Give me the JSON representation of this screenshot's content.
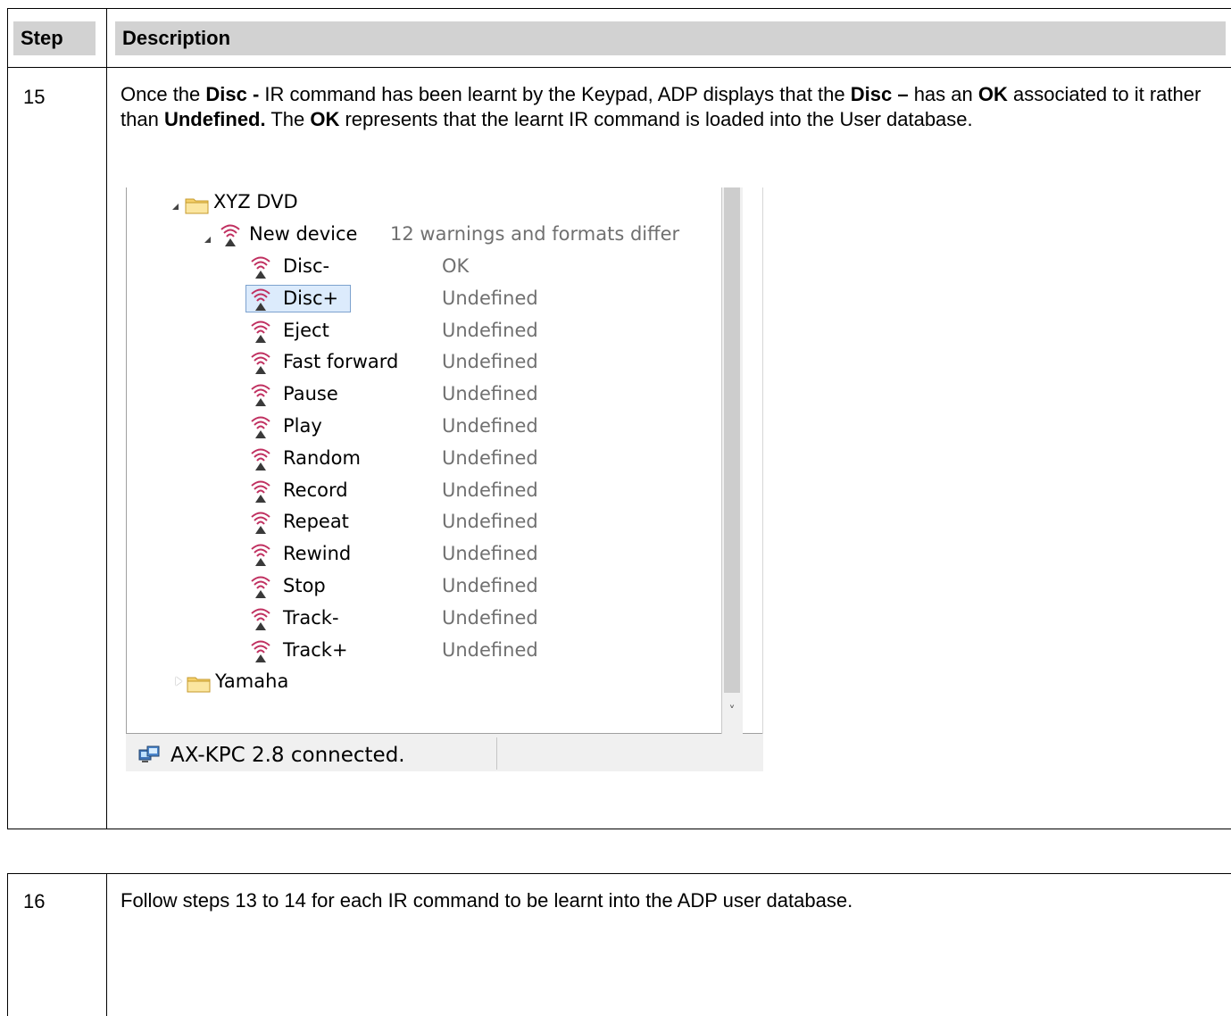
{
  "header": {
    "step": "Step",
    "description": "Description"
  },
  "row15": {
    "step": "15",
    "text": [
      {
        "t": "Once the ",
        "b": false
      },
      {
        "t": "Disc - ",
        "b": true
      },
      {
        "t": "IR command has been learnt by the Keypad, ADP displays that the ",
        "b": false
      },
      {
        "t": "Disc –",
        "b": true
      },
      {
        "t": " has an ",
        "b": false
      },
      {
        "t": "OK",
        "b": true
      },
      {
        "t": " associated to it rather than ",
        "b": false
      },
      {
        "t": "Undefined.",
        "b": true
      },
      {
        "t": " The ",
        "b": false
      },
      {
        "t": "OK",
        "b": true
      },
      {
        "t": " represents that the learnt IR command is loaded into the User database.",
        "b": false
      }
    ]
  },
  "tree": {
    "folder1": "XYZ DVD",
    "device": {
      "name": "New device",
      "status": "12 warnings and formats differ"
    },
    "commands": [
      {
        "name": "Disc-",
        "status": "OK"
      },
      {
        "name": "Disc+",
        "status": "Undefined",
        "selected": true
      },
      {
        "name": "Eject",
        "status": "Undefined"
      },
      {
        "name": "Fast forward",
        "status": "Undefined"
      },
      {
        "name": "Pause",
        "status": "Undefined"
      },
      {
        "name": "Play",
        "status": "Undefined"
      },
      {
        "name": "Random",
        "status": "Undefined"
      },
      {
        "name": "Record",
        "status": "Undefined"
      },
      {
        "name": "Repeat",
        "status": "Undefined"
      },
      {
        "name": "Rewind",
        "status": "Undefined"
      },
      {
        "name": "Stop",
        "status": "Undefined"
      },
      {
        "name": "Track-",
        "status": "Undefined"
      },
      {
        "name": "Track+",
        "status": "Undefined"
      }
    ],
    "folder2": "Yamaha",
    "icons": {
      "folder": "folder-icon",
      "ir": "ir-signal-icon",
      "expanded": "expanded-arrow-icon",
      "collapsed": "collapsed-arrow-icon"
    }
  },
  "statusbar": {
    "text": "AX-KPC 2.8 connected.",
    "icon": "network-connected-icon"
  },
  "row16": {
    "step": "16",
    "text": "Follow steps 13 to 14 for each IR command to be learnt into the ADP user database."
  },
  "colors": {
    "ir_icon": "#c03060",
    "folder": "#f5d06a",
    "selection_fill": "#dcebfc",
    "selection_border": "#7da2ce",
    "status_text": "#707070"
  }
}
